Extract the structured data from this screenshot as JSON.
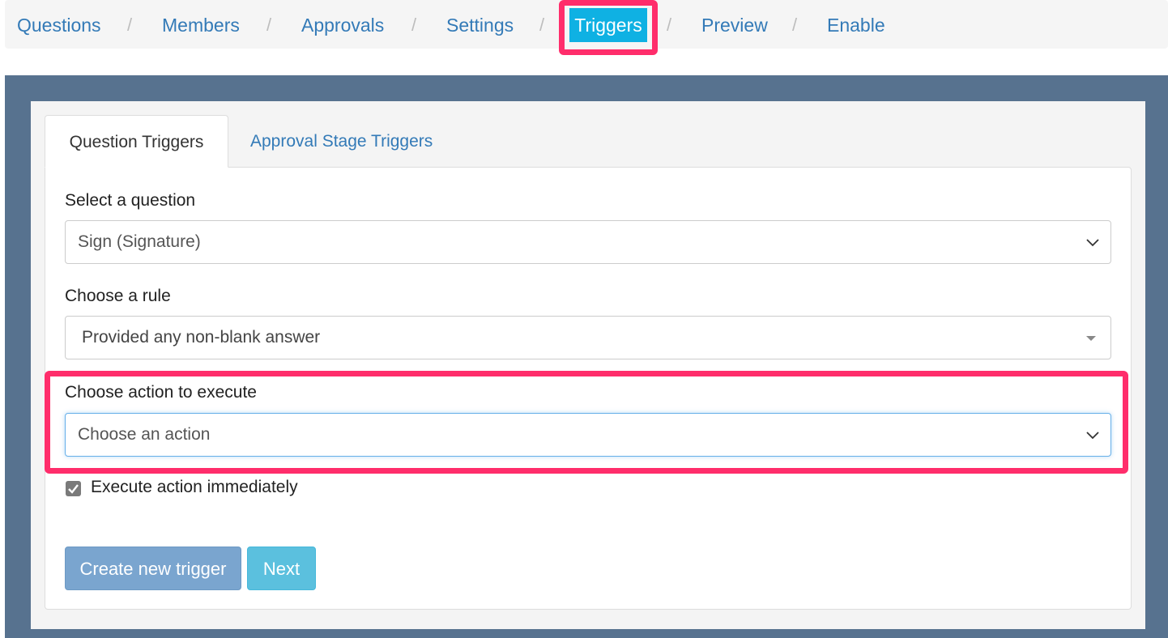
{
  "breadcrumb": {
    "items": [
      "Questions",
      "Members",
      "Approvals",
      "Settings",
      "Triggers",
      "Preview",
      "Enable"
    ],
    "separator": "/",
    "active": "Triggers",
    "active_color": "#0fb1e3",
    "highlight_color": "#ff2d6b"
  },
  "tabs": {
    "question_triggers": "Question Triggers",
    "approval_stage_triggers": "Approval Stage Triggers"
  },
  "form": {
    "question_label": "Select a question",
    "question_value": "Sign (Signature)",
    "rule_label": "Choose a rule",
    "rule_value": "Provided any non-blank answer",
    "action_label": "Choose action to execute",
    "action_placeholder": "Choose an action",
    "execute_immediately_label": "Execute action immediately",
    "execute_immediately_checked": true
  },
  "buttons": {
    "create_trigger": "Create new trigger",
    "next": "Next"
  },
  "icons": {
    "select_chevron": "chevron-down-icon",
    "select2_caret": "caret-down-icon",
    "checkbox": "checkmark-icon"
  }
}
